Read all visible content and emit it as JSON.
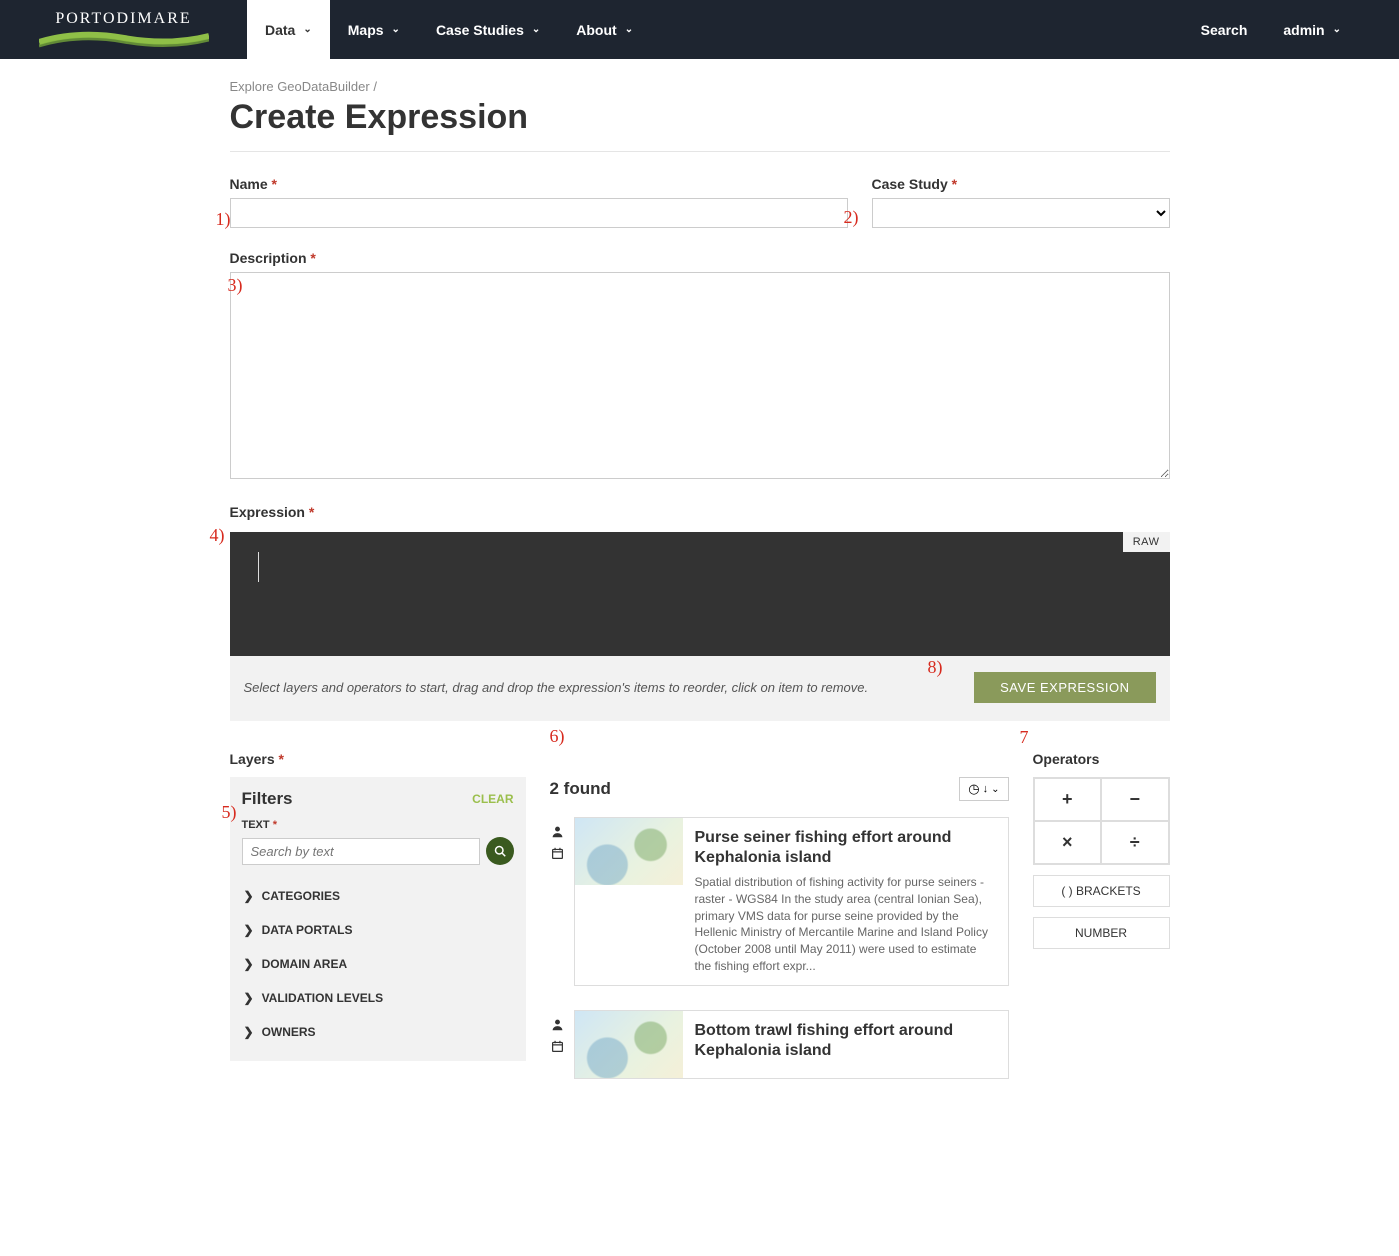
{
  "brand": "PORTODIMARE",
  "nav": {
    "items": [
      {
        "label": "Data",
        "active": true
      },
      {
        "label": "Maps",
        "active": false
      },
      {
        "label": "Case Studies",
        "active": false
      },
      {
        "label": "About",
        "active": false
      }
    ],
    "search": "Search",
    "user": "admin"
  },
  "breadcrumb": {
    "link": "Explore GeoDataBuilder",
    "sep": " /"
  },
  "title": "Create Expression",
  "form": {
    "name_label": "Name",
    "case_study_label": "Case Study",
    "description_label": "Description",
    "expression_label": "Expression",
    "raw_label": "RAW",
    "hint": "Select layers and operators to start, drag and drop the expression's items to reorder, click on item to remove.",
    "save_label": "SAVE EXPRESSION"
  },
  "layers": {
    "label": "Layers",
    "filters_title": "Filters",
    "clear": "CLEAR",
    "text_label": "TEXT",
    "search_placeholder": "Search by text",
    "categories": [
      "CATEGORIES",
      "DATA PORTALS",
      "DOMAIN AREA",
      "VALIDATION LEVELS",
      "OWNERS"
    ]
  },
  "results": {
    "count_text": "2 found",
    "items": [
      {
        "title": "Purse seiner fishing effort around Kephalonia island",
        "desc": "Spatial distribution of fishing activity for purse seiners - raster - WGS84 In the study area (central Ionian Sea), primary VMS data for purse seine provided by the Hellenic Ministry of Mercantile Marine and Island Policy (October 2008 until May 2011) were used to estimate the fishing effort expr..."
      },
      {
        "title": "Bottom trawl fishing effort around Kephalonia island",
        "desc": ""
      }
    ]
  },
  "operators": {
    "label": "Operators",
    "ops": [
      "+",
      "−",
      "×",
      "÷"
    ],
    "brackets": "( ) BRACKETS",
    "number": "NUMBER"
  },
  "annotations": {
    "a1": "1)",
    "a2": "2)",
    "a3": "3)",
    "a4": "4)",
    "a5": "5)",
    "a6": "6)",
    "a7": "7",
    "a8": "8)"
  }
}
